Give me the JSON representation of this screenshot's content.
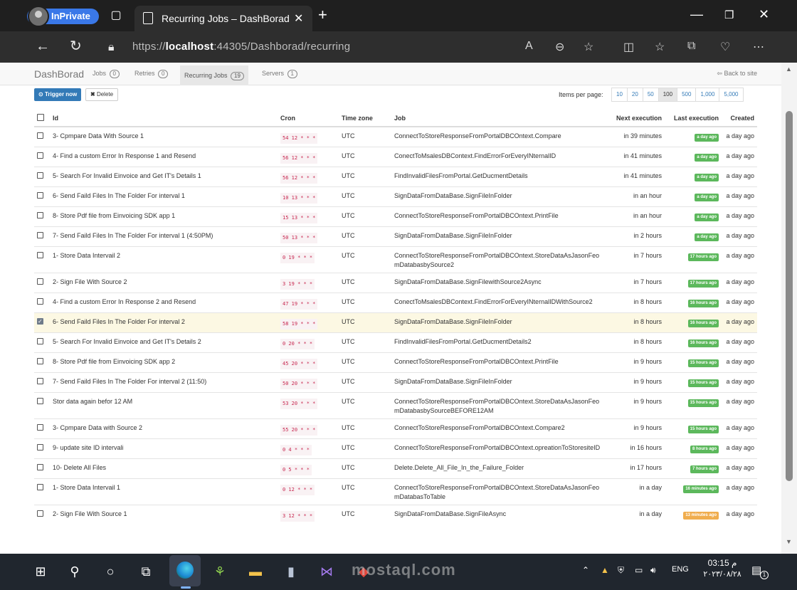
{
  "browser": {
    "profile_label": "InPrivate",
    "tab_title": "Recurring Jobs – DashBorad",
    "url_prefix": "https://",
    "url_host": "localhost",
    "url_rest": ":44305/Dashborad/recurring"
  },
  "nav": {
    "brand": "DashBorad",
    "items": [
      {
        "label": "Jobs",
        "count": "0"
      },
      {
        "label": "Retries",
        "count": "0"
      },
      {
        "label": "Recurring Jobs",
        "count": "19"
      },
      {
        "label": "Servers",
        "count": "1"
      }
    ],
    "back_label": "Back to site"
  },
  "toolbar": {
    "trigger_label": "Trigger now",
    "delete_label": "Delete",
    "items_per_page_label": "Items per page:",
    "page_sizes": [
      "10",
      "20",
      "50",
      "100",
      "500",
      "1,000",
      "5,000"
    ],
    "selected_page_size": "100"
  },
  "table": {
    "columns": [
      "Id",
      "Cron",
      "Time zone",
      "Job",
      "Next execution",
      "Last execution",
      "Created"
    ],
    "rows": [
      {
        "id": "3- Cpmpare Data With Source 1",
        "cron": "54 12 * * *",
        "tz": "UTC",
        "job": "ConnectToStoreResponseFromPortalDBCOntext.Compare",
        "next": "in 39 minutes",
        "last": "a day ago",
        "last_color": "green",
        "created": "a day ago",
        "checked": false
      },
      {
        "id": "4- Find a custom Error In Response 1 and Resend",
        "cron": "56 12 * * *",
        "tz": "UTC",
        "job": "ConectToMsalesDBContext.FindErrorForEveryINternalID",
        "next": "in 41 minutes",
        "last": "a day ago",
        "last_color": "green",
        "created": "a day ago",
        "checked": false
      },
      {
        "id": "5- Search For Invalid Einvoice and Get IT's Details 1",
        "cron": "56 12 * * *",
        "tz": "UTC",
        "job": "FindInvalidFilesFromPortal.GetDucmentDetails",
        "next": "in 41 minutes",
        "last": "a day ago",
        "last_color": "green",
        "created": "a day ago",
        "checked": false
      },
      {
        "id": "6- Send Faild Files In The Folder For interval 1",
        "cron": "10 13 * * *",
        "tz": "UTC",
        "job": "SignDataFromDataBase.SignFileInFolder",
        "next": "in an hour",
        "last": "a day ago",
        "last_color": "green",
        "created": "a day ago",
        "checked": false
      },
      {
        "id": "8- Store Pdf file from Einvoicing SDK app 1",
        "cron": "15 13 * * *",
        "tz": "UTC",
        "job": "ConnectToStoreResponseFromPortalDBCOntext.PrintFile",
        "next": "in an hour",
        "last": "a day ago",
        "last_color": "green",
        "created": "a day ago",
        "checked": false
      },
      {
        "id": "7- Send Faild Files In The Folder For interval 1 (4:50PM)",
        "cron": "50 13 * * *",
        "tz": "UTC",
        "job": "SignDataFromDataBase.SignFileInFolder",
        "next": "in 2 hours",
        "last": "a day ago",
        "last_color": "green",
        "created": "a day ago",
        "checked": false
      },
      {
        "id": "1- Store Data Intervail 2",
        "cron": "0 19 * * *",
        "tz": "UTC",
        "job": "ConnectToStoreResponseFromPortalDBCOntext.StoreDataAsJasonFeomDatabasbySource2",
        "next": "in 7 hours",
        "last": "17 hours ago",
        "last_color": "green",
        "created": "a day ago",
        "checked": false
      },
      {
        "id": "2- Sign File With Source 2",
        "cron": "3 19 * * *",
        "tz": "UTC",
        "job": "SignDataFromDataBase.SignFilewithSource2Async",
        "next": "in 7 hours",
        "last": "17 hours ago",
        "last_color": "green",
        "created": "a day ago",
        "checked": false
      },
      {
        "id": "4- Find a custom Error In Response 2 and Resend",
        "cron": "47 19 * * *",
        "tz": "UTC",
        "job": "ConectToMsalesDBContext.FindErrorForEveryINternalIDWithSource2",
        "next": "in 8 hours",
        "last": "16 hours ago",
        "last_color": "green",
        "created": "a day ago",
        "checked": false
      },
      {
        "id": "6- Send Faild Files In The Folder For interval 2",
        "cron": "58 19 * * *",
        "tz": "UTC",
        "job": "SignDataFromDataBase.SignFileInFolder",
        "next": "in 8 hours",
        "last": "16 hours ago",
        "last_color": "green",
        "created": "a day ago",
        "checked": true
      },
      {
        "id": "5- Search For Invalid Einvoice and Get IT's Details 2",
        "cron": "0 20 * * *",
        "tz": "UTC",
        "job": "FindInvalidFilesFromPortal.GetDucmentDetails2",
        "next": "in 8 hours",
        "last": "16 hours ago",
        "last_color": "green",
        "created": "a day ago",
        "checked": false
      },
      {
        "id": "8- Store Pdf file from Einvoicing SDK app 2",
        "cron": "45 20 * * *",
        "tz": "UTC",
        "job": "ConnectToStoreResponseFromPortalDBCOntext.PrintFile",
        "next": "in 9 hours",
        "last": "15 hours ago",
        "last_color": "green",
        "created": "a day ago",
        "checked": false
      },
      {
        "id": "7- Send Faild Files In The Folder For interval 2 (11:50)",
        "cron": "50 20 * * *",
        "tz": "UTC",
        "job": "SignDataFromDataBase.SignFileInFolder",
        "next": "in 9 hours",
        "last": "15 hours ago",
        "last_color": "green",
        "created": "a day ago",
        "checked": false
      },
      {
        "id": "Stor data again befor 12 AM",
        "cron": "53 20 * * *",
        "tz": "UTC",
        "job": "ConnectToStoreResponseFromPortalDBCOntext.StoreDataAsJasonFeomDatabasbySourceBEFORE12AM",
        "next": "in 9 hours",
        "last": "15 hours ago",
        "last_color": "green",
        "created": "a day ago",
        "checked": false
      },
      {
        "id": "3- Cpmpare Data with Source 2",
        "cron": "55 20 * * *",
        "tz": "UTC",
        "job": "ConnectToStoreResponseFromPortalDBCOntext.Compare2",
        "next": "in 9 hours",
        "last": "15 hours ago",
        "last_color": "green",
        "created": "a day ago",
        "checked": false
      },
      {
        "id": "9- update site ID intervali",
        "cron": "0 4 * * *",
        "tz": "UTC",
        "job": "ConnectToStoreResponseFromPortalDBCOntext.opreationToStoresiteID",
        "next": "in 16 hours",
        "last": "8 hours ago",
        "last_color": "green",
        "created": "a day ago",
        "checked": false
      },
      {
        "id": "10- Delete All Files",
        "cron": "0 5 * * *",
        "tz": "UTC",
        "job": "Delete.Delete_All_File_In_the_Failure_Folder",
        "next": "in 17 hours",
        "last": "7 hours ago",
        "last_color": "green",
        "created": "a day ago",
        "checked": false
      },
      {
        "id": "1- Store Data Intervail 1",
        "cron": "0 12 * * *",
        "tz": "UTC",
        "job": "ConnectToStoreResponseFromPortalDBCOntext.StoreDataAsJasonFeomDatabasToTable",
        "next": "in a day",
        "last": "16 minutes ago",
        "last_color": "green",
        "created": "a day ago",
        "checked": false
      },
      {
        "id": "2- Sign File With Source 1",
        "cron": "3 12 * * *",
        "tz": "UTC",
        "job": "SignDataFromDataBase.SignFileAsync",
        "next": "in a day",
        "last": "13 minutes ago",
        "last_color": "orange",
        "created": "a day ago",
        "checked": false
      }
    ]
  },
  "taskbar": {
    "tray_lang": "ENG",
    "clock_time": "03:15 م",
    "clock_date": "٢٠٢٣/٠٨/٢٨",
    "notification_count": "1",
    "watermark": "mostaql.com"
  },
  "colors": {
    "primary": "#337ab7",
    "success": "#5cb85c",
    "warning": "#f0ad4e",
    "cron_text": "#c7254e",
    "selected_row": "#fcf8e3"
  }
}
